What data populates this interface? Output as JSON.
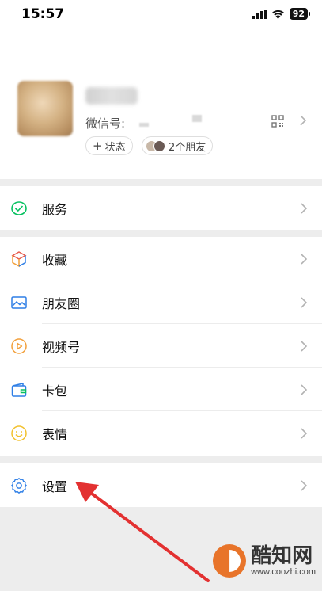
{
  "status_bar": {
    "time": "15:57",
    "battery": "92"
  },
  "profile": {
    "wechat_id_label": "微信号:",
    "status_button": "状态",
    "friends_button": "2个朋友"
  },
  "menu": {
    "service": "服务",
    "favorites": "收藏",
    "moments": "朋友圈",
    "channels": "视频号",
    "cards": "卡包",
    "stickers": "表情",
    "settings": "设置"
  },
  "watermark": {
    "name": "酷知网",
    "url": "www.coozhi.com"
  },
  "colors": {
    "accent_green": "#07c160",
    "annotation_red": "#e33131",
    "icon_blue": "#2f7fe6",
    "icon_orange": "#f2a03c"
  }
}
